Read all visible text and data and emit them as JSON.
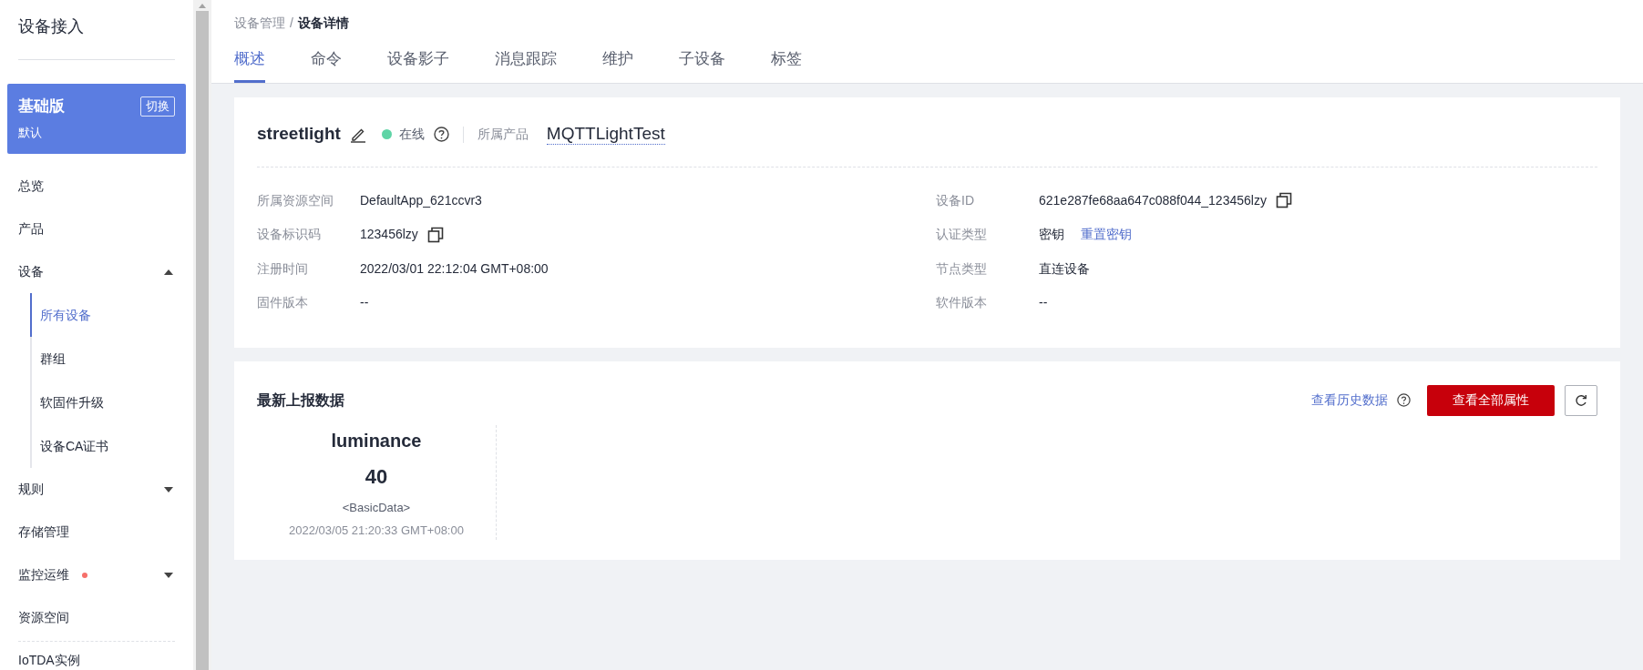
{
  "sidebar": {
    "title": "设备接入",
    "edition": {
      "name": "基础版",
      "sub": "默认",
      "switch_label": "切换"
    },
    "items": [
      {
        "kind": "link",
        "label": "总览",
        "selected": false,
        "alert": false
      },
      {
        "kind": "link",
        "label": "产品",
        "selected": false,
        "alert": false
      },
      {
        "kind": "group",
        "label": "设备",
        "selected": false,
        "alert": false,
        "expanded": true,
        "children": [
          {
            "label": "所有设备",
            "selected": true
          },
          {
            "label": "群组",
            "selected": false
          },
          {
            "label": "软固件升级",
            "selected": false
          },
          {
            "label": "设备CA证书",
            "selected": false
          }
        ]
      },
      {
        "kind": "group",
        "label": "规则",
        "selected": false,
        "alert": false,
        "expanded": false
      },
      {
        "kind": "link",
        "label": "存储管理",
        "selected": false,
        "alert": false
      },
      {
        "kind": "group",
        "label": "监控运维",
        "selected": false,
        "alert": true,
        "expanded": false
      },
      {
        "kind": "link",
        "label": "资源空间",
        "selected": false,
        "alert": false
      }
    ],
    "footer_item": "IoTDA实例"
  },
  "breadcrumb": {
    "parent": "设备管理",
    "separator": "/",
    "current": "设备详情"
  },
  "tabs": [
    {
      "label": "概述",
      "selected": true
    },
    {
      "label": "命令",
      "selected": false
    },
    {
      "label": "设备影子",
      "selected": false
    },
    {
      "label": "消息跟踪",
      "selected": false
    },
    {
      "label": "维护",
      "selected": false
    },
    {
      "label": "子设备",
      "selected": false
    },
    {
      "label": "标签",
      "selected": false
    }
  ],
  "device": {
    "name": "streetlight",
    "status": "在线",
    "online": true,
    "product_label": "所属产品",
    "product": "MQTTLightTest",
    "fields": [
      {
        "label": "所属资源空间",
        "value": "DefaultApp_621ccvr3",
        "copyable": false
      },
      {
        "label": "设备ID",
        "value": "621e287fe68aa647c088f044_123456lzy",
        "copyable": true
      },
      {
        "label": "设备标识码",
        "value": "123456lzy",
        "copyable": true
      },
      {
        "label": "认证类型",
        "value": "密钥",
        "copyable": false,
        "action": "重置密钥"
      },
      {
        "label": "注册时间",
        "value": "2022/03/01 22:12:04 GMT+08:00",
        "copyable": false
      },
      {
        "label": "节点类型",
        "value": "直连设备",
        "copyable": false
      },
      {
        "label": "固件版本",
        "value": "--",
        "copyable": false
      },
      {
        "label": "软件版本",
        "value": "--",
        "copyable": false
      }
    ]
  },
  "latest_data": {
    "title": "最新上报数据",
    "history_link": "查看历史数据",
    "all_button": "查看全部属性",
    "properties": [
      {
        "name": "luminance",
        "value": "40",
        "type": "<BasicData>",
        "time": "2022/03/05 21:20:33 GMT+08:00"
      }
    ]
  }
}
